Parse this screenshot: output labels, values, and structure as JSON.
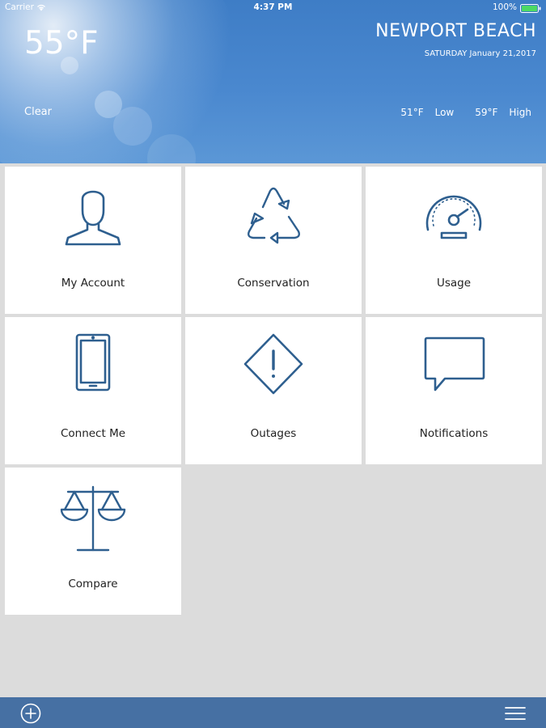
{
  "status_bar": {
    "carrier": "Carrier",
    "time": "4:37 PM",
    "battery": "100%"
  },
  "weather": {
    "current_temp": "55°F",
    "city": "NEWPORT BEACH",
    "date": "SATURDAY January 21,2017",
    "condition": "Clear",
    "low_temp": "51°F",
    "low_label": "Low",
    "high_temp": "59°F",
    "high_label": "High"
  },
  "tiles": [
    {
      "label": "My Account",
      "icon": "user-icon"
    },
    {
      "label": "Conservation",
      "icon": "recycle-icon"
    },
    {
      "label": "Usage",
      "icon": "speedometer-icon"
    },
    {
      "label": "Connect Me",
      "icon": "tablet-icon"
    },
    {
      "label": "Outages",
      "icon": "warning-icon"
    },
    {
      "label": "Notifications",
      "icon": "chat-bubble-icon"
    },
    {
      "label": "Compare",
      "icon": "scale-icon"
    }
  ],
  "colors": {
    "icon_stroke": "#2e5f8f",
    "bottom_bar": "#4670a3",
    "header_blue": "#4a88cf",
    "background": "#dcdcdc"
  },
  "bottom_bar": {
    "left_icon": "add-circle-icon",
    "right_icon": "menu-icon"
  }
}
